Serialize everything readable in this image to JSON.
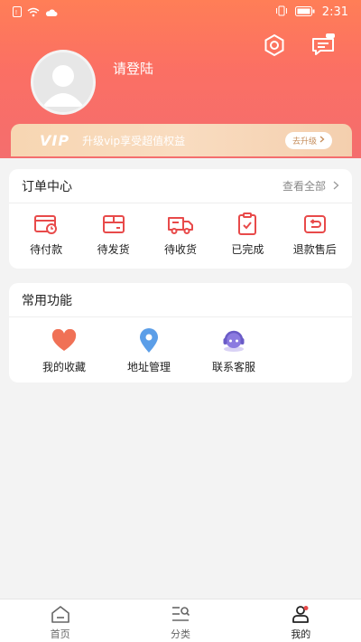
{
  "status_bar": {
    "time": "2:31"
  },
  "profile": {
    "login_prompt": "请登陆"
  },
  "vip": {
    "logo": "VIP",
    "text": "升级vip享受超值权益",
    "button": "去升级"
  },
  "order_center": {
    "title": "订单中心",
    "view_all": "查看全部",
    "items": [
      {
        "label": "待付款",
        "icon": "pending-payment-icon"
      },
      {
        "label": "待发货",
        "icon": "pending-shipment-icon"
      },
      {
        "label": "待收货",
        "icon": "pending-receipt-icon"
      },
      {
        "label": "已完成",
        "icon": "completed-icon"
      },
      {
        "label": "退款售后",
        "icon": "refund-icon"
      }
    ]
  },
  "common_functions": {
    "title": "常用功能",
    "items": [
      {
        "label": "我的收藏",
        "icon": "heart-icon"
      },
      {
        "label": "地址管理",
        "icon": "location-pin-icon"
      },
      {
        "label": "联系客服",
        "icon": "customer-service-icon"
      }
    ]
  },
  "tabbar": {
    "tabs": [
      {
        "label": "首页",
        "icon": "home-icon"
      },
      {
        "label": "分类",
        "icon": "category-icon"
      },
      {
        "label": "我的",
        "icon": "profile-icon"
      }
    ],
    "active_index": 2
  },
  "colors": {
    "accent": "#e84a4a",
    "header_top": "#ff7e57",
    "header_bottom": "#f46e6e",
    "vip_gold": "#f7d6b2"
  }
}
